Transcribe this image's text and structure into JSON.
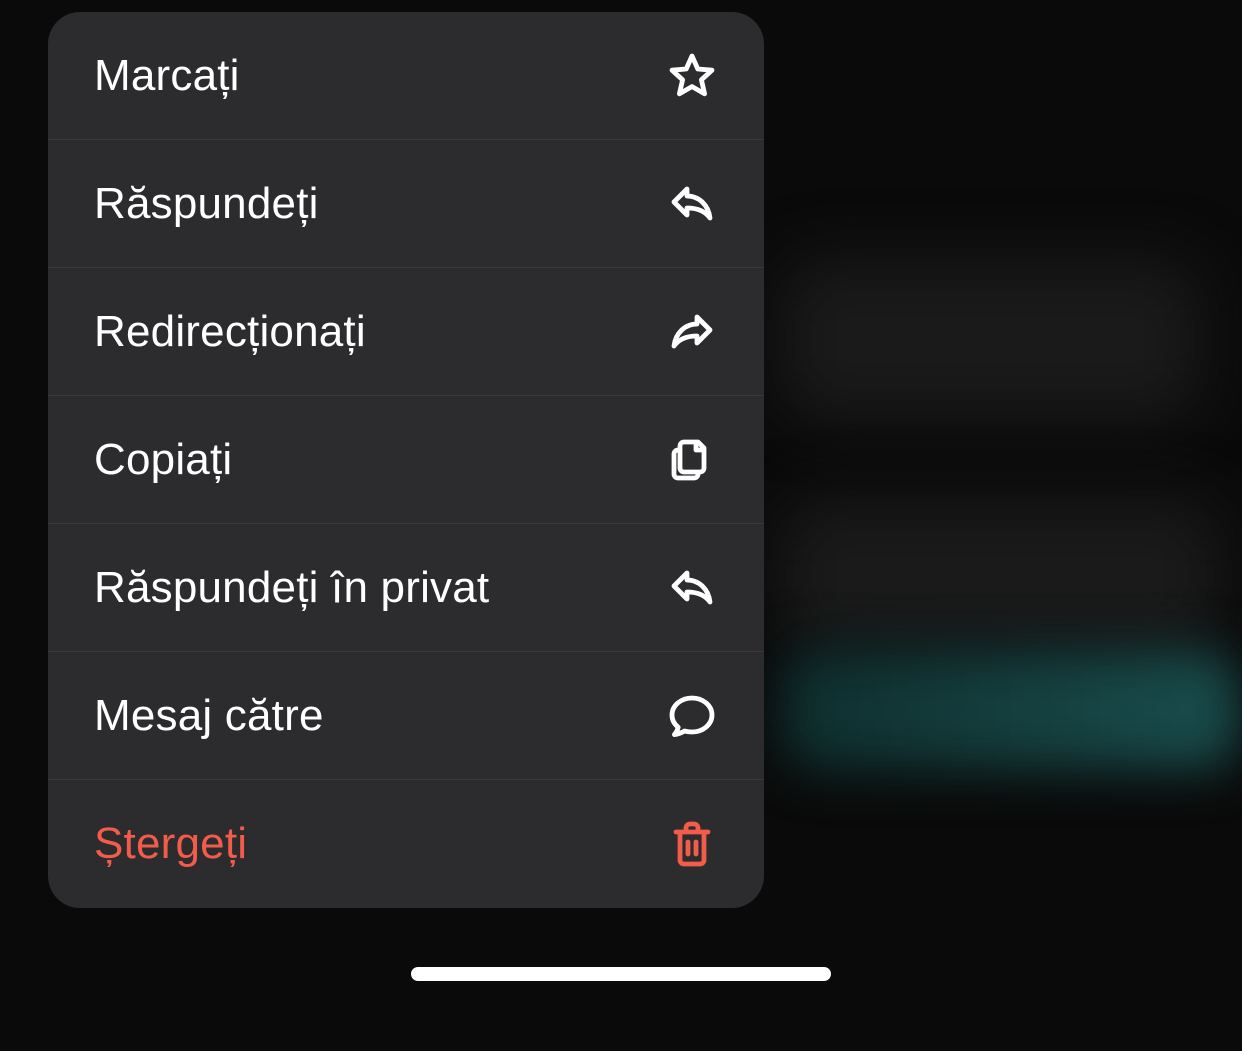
{
  "menu": {
    "items": [
      {
        "label": "Marcați",
        "icon": "star-icon",
        "destructive": false
      },
      {
        "label": "Răspundeți",
        "icon": "reply-icon",
        "destructive": false
      },
      {
        "label": "Redirecționați",
        "icon": "forward-icon",
        "destructive": false
      },
      {
        "label": "Copiați",
        "icon": "copy-icon",
        "destructive": false
      },
      {
        "label": "Răspundeți în privat",
        "icon": "reply-icon",
        "destructive": false
      },
      {
        "label": "Mesaj către",
        "icon": "chat-icon",
        "destructive": false
      },
      {
        "label": "Ștergeți",
        "icon": "trash-icon",
        "destructive": true
      }
    ]
  },
  "colors": {
    "background": "#0a0a0a",
    "menuBackground": "#2c2b2d",
    "text": "#ffffff",
    "destructive": "#f25c4a"
  }
}
